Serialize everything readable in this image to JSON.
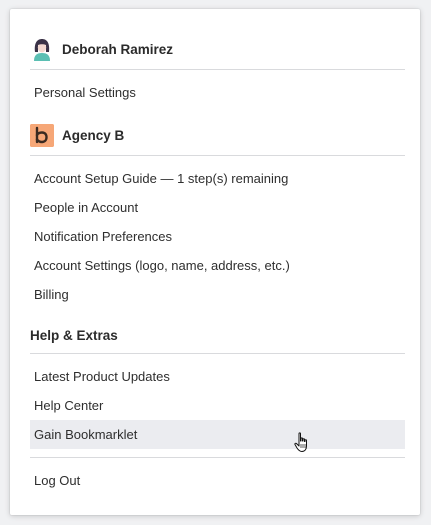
{
  "user": {
    "name": "Deborah Ramirez",
    "personal_settings_label": "Personal Settings"
  },
  "account": {
    "name": "Agency B",
    "items": [
      {
        "label": "Account Setup Guide — 1 step(s) remaining"
      },
      {
        "label": "People in Account"
      },
      {
        "label": "Notification Preferences"
      },
      {
        "label": "Account Settings (logo, name, address, etc.)"
      },
      {
        "label": "Billing"
      }
    ]
  },
  "help": {
    "title": "Help & Extras",
    "items": [
      {
        "label": "Latest Product Updates"
      },
      {
        "label": "Help Center"
      },
      {
        "label": "Gain Bookmarklet",
        "hovered": true
      }
    ]
  },
  "logout_label": "Log Out",
  "colors": {
    "agency_logo_bg": "#f6a777",
    "agency_logo_fg": "#3a2a20",
    "hover_bg": "#ebecf0",
    "divider": "#d9dadd",
    "avatar_hair": "#3b3247",
    "avatar_shirt": "#5bbfb3"
  },
  "icons": [
    "user-avatar-icon",
    "agency-logo-icon",
    "hand-pointer-cursor-icon"
  ]
}
